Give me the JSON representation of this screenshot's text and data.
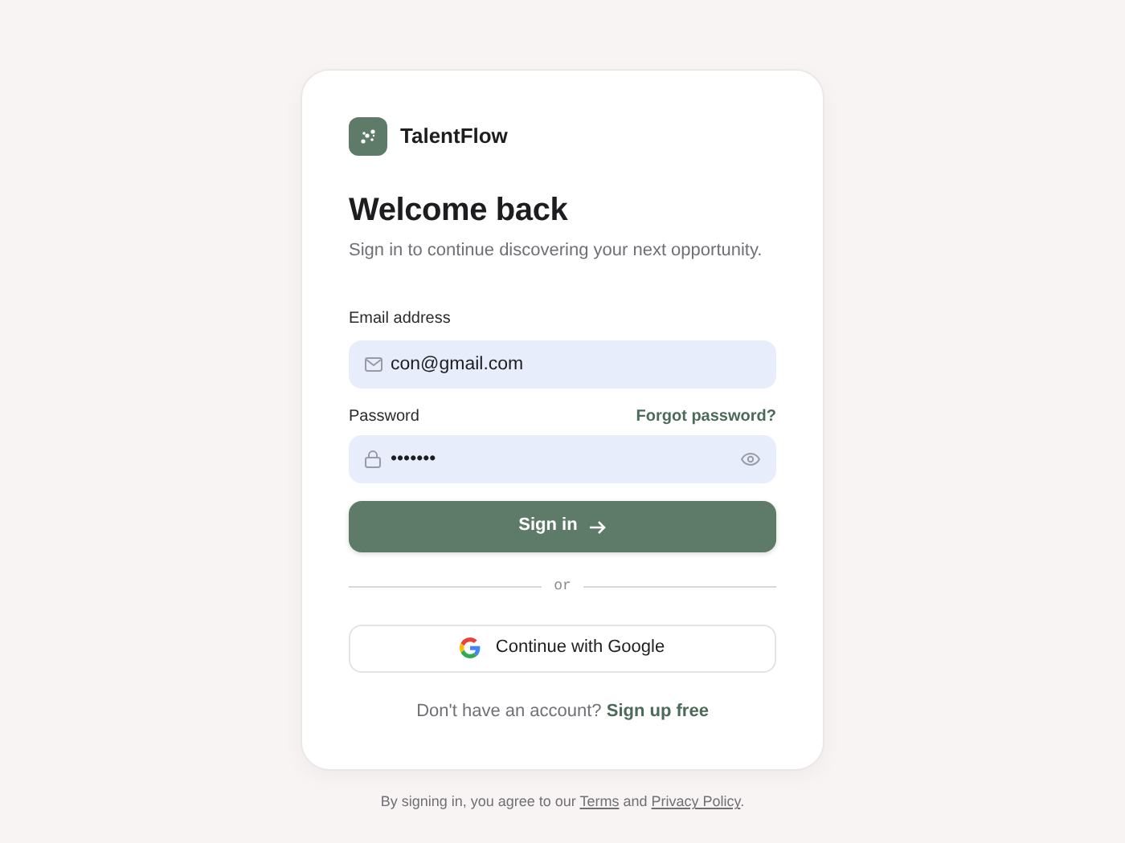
{
  "brand": {
    "name": "TalentFlow"
  },
  "heading": "Welcome back",
  "subtitle": "Sign in to continue discovering your next opportunity.",
  "email": {
    "label": "Email address",
    "value": "con@gmail.com"
  },
  "password": {
    "label": "Password",
    "forgot_link": "Forgot password?",
    "value": "•••••••"
  },
  "sign_in_button": "Sign in",
  "divider": "or",
  "google_button": "Continue with Google",
  "signup": {
    "text": "Don't have an account?",
    "link": "Sign up free"
  },
  "footer": {
    "before": "By signing in, you agree to our",
    "terms": "Terms",
    "and": "and",
    "privacy": "Privacy Policy",
    "after": "."
  }
}
